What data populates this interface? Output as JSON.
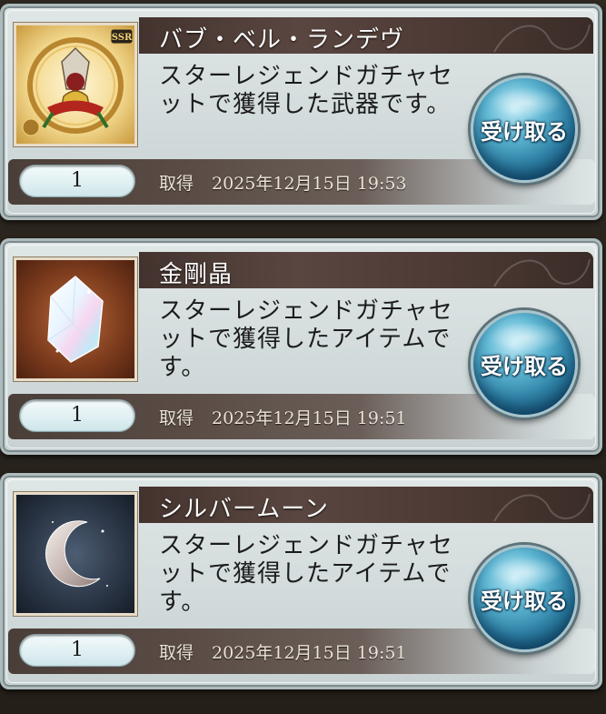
{
  "items": [
    {
      "name": "バブ・ベル・ランデヴ",
      "description": "スターレジェンドガチャセットで獲得した武器です。",
      "rarity": "SSR",
      "quantity": "1",
      "acquired_label": "取得",
      "acquired_date": "2025年12月15日 19:53",
      "button_label": "受け取る",
      "icon": "bell-weapon-icon"
    },
    {
      "name": "金剛晶",
      "description": "スターレジェンドガチャセットで獲得したアイテムです。",
      "quantity": "1",
      "acquired_label": "取得",
      "acquired_date": "2025年12月15日 19:51",
      "button_label": "受け取る",
      "icon": "crystal-icon"
    },
    {
      "name": "シルバームーン",
      "description": "スターレジェンドガチャセットで獲得したアイテムです。",
      "quantity": "1",
      "acquired_label": "取得",
      "acquired_date": "2025年12月15日 19:51",
      "button_label": "受け取る",
      "icon": "silver-moon-icon"
    }
  ],
  "colors": {
    "title_bar": "#4c3934",
    "button": "#2d7fa3",
    "panel": "#dfe6e6"
  }
}
